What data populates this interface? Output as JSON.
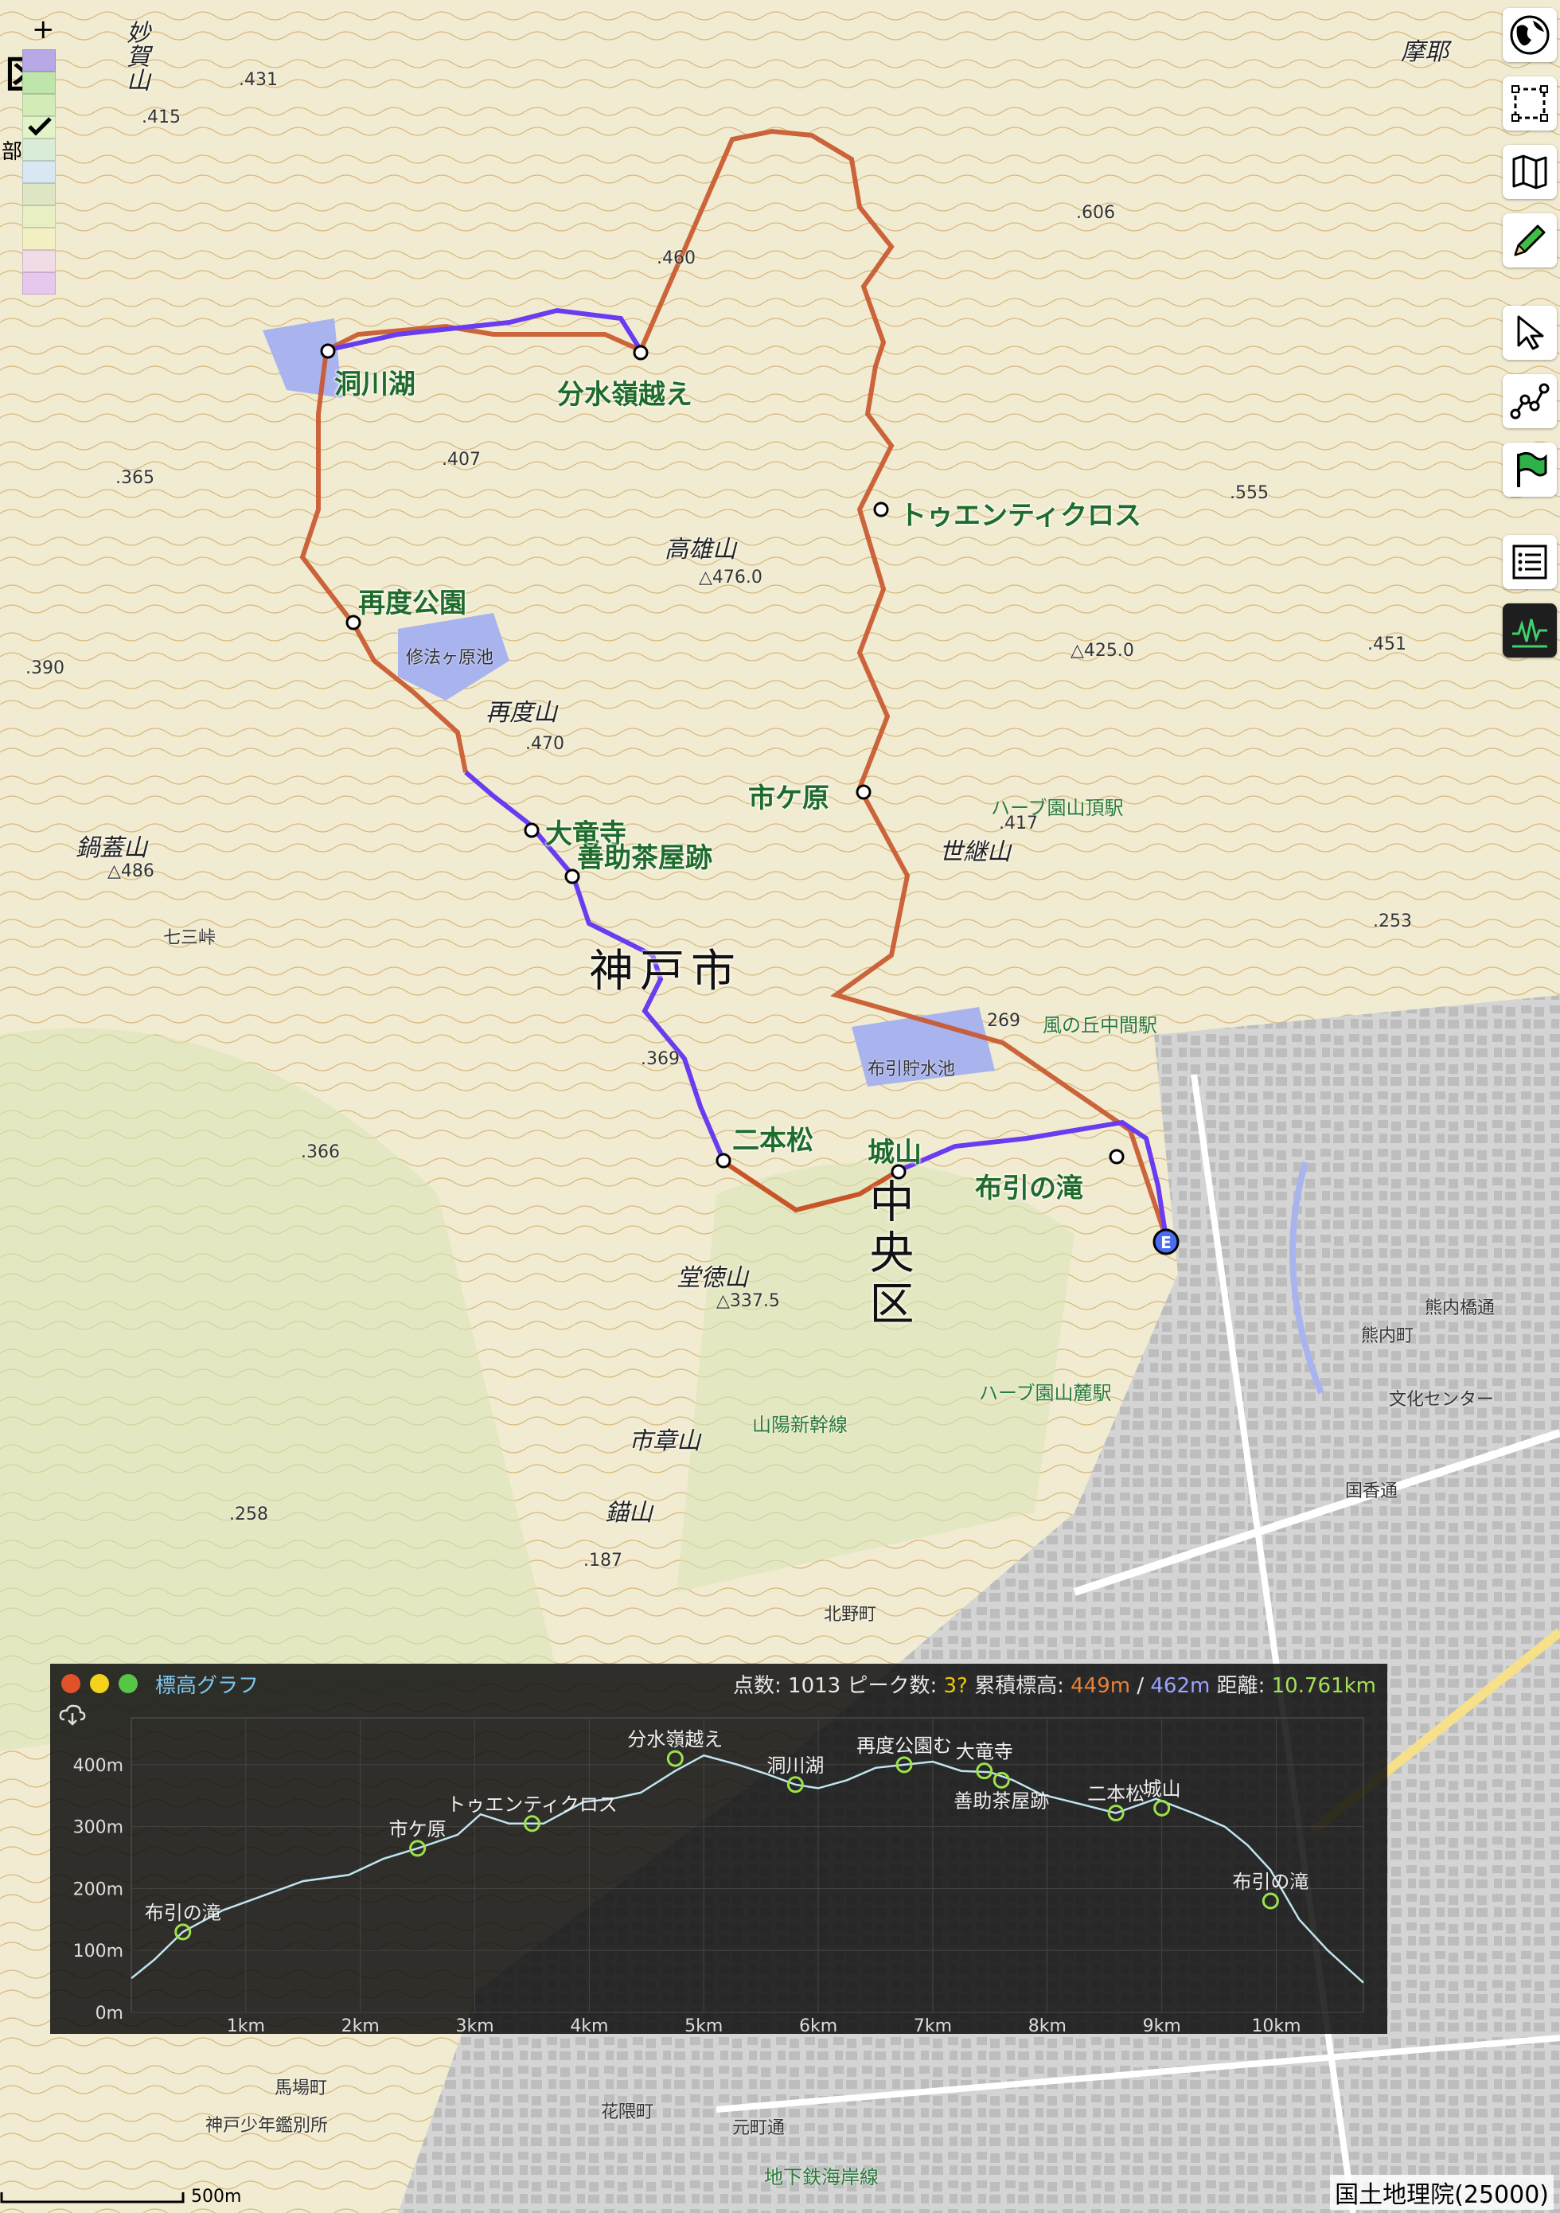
{
  "map": {
    "city_label": "神戸市",
    "ward_label": "中央区",
    "waypoints": [
      "洞川湖",
      "分水嶺越え",
      "トゥエンティクロス",
      "再度公園",
      "市ケ原",
      "大竜寺",
      "善助茶屋跡",
      "二本松",
      "城山",
      "布引の滝"
    ],
    "mountains": [
      "妙賀山",
      "高雄山",
      "再度山",
      "鍋蓋山",
      "世継山",
      "堂徳山",
      "市章山",
      "錨山",
      "摩耶"
    ],
    "places": [
      "修法ヶ原池",
      "布引貯水池",
      "ハーブ園山頂駅",
      "風の丘中間駅",
      "ハーブ園山麓駅",
      "山陽新幹線",
      "熊内町",
      "熊内橋通",
      "文化センター",
      "国香通",
      "北野町",
      "馬場町",
      "神戸少年鑑別所",
      "花隈町",
      "元町通",
      "七三峠",
      "地下鉄海岸線"
    ],
    "spot_heights": [
      ".431",
      ".415",
      ".460",
      ".407",
      ".365",
      "△476.0",
      ".390",
      ".470",
      "△486",
      ".417",
      ".366",
      ".369",
      ".258",
      "△337.5",
      ".187",
      ".606",
      ".555",
      "△425.0",
      ".451",
      ".253",
      "269"
    ],
    "route_colors": {
      "ascent": "#c8552a",
      "descent": "#6a3cf0",
      "waypoint_fill": "#ffffff"
    },
    "end_marker": "E",
    "scale_label": "500m",
    "attribution": "国土地理院(25000)"
  },
  "legend": {
    "zoom_label": "+",
    "ward_symbol": "区",
    "side_text": "部",
    "checkbox_checked": true
  },
  "toolbar": [
    {
      "icon": "globe-icon"
    },
    {
      "icon": "select-rect-icon"
    },
    {
      "icon": "map-icon"
    },
    {
      "icon": "pencil-icon"
    },
    {
      "icon": "cursor-icon"
    },
    {
      "icon": "route-icon"
    },
    {
      "icon": "flag-icon"
    },
    {
      "icon": "list-icon"
    },
    {
      "icon": "elevation-icon"
    }
  ],
  "elevation": {
    "title": "標高グラフ",
    "stats": {
      "points_label": "点数:",
      "points": "1013",
      "peaks_label": "ピーク数:",
      "peaks": "3?",
      "gain_label": "累積標高:",
      "gain_up": "449m",
      "sep": "/",
      "gain_down": "462m",
      "dist_label": "距離:",
      "distance": "10.761km"
    },
    "colors": {
      "peaks": "#f0c800",
      "up": "#e8823a",
      "down": "#9aa3ff",
      "dist": "#a4e05a",
      "line": "#bfe5f0"
    },
    "chart_data": {
      "type": "line",
      "xlim": [
        0,
        10.761
      ],
      "ylim": [
        0,
        450
      ],
      "x_ticks": [
        "1km",
        "2km",
        "3km",
        "4km",
        "5km",
        "6km",
        "7km",
        "8km",
        "9km",
        "10km"
      ],
      "y_ticks": [
        "0m",
        "100m",
        "200m",
        "300m",
        "400m"
      ],
      "profile": [
        [
          0,
          55
        ],
        [
          0.2,
          85
        ],
        [
          0.45,
          130
        ],
        [
          0.8,
          165
        ],
        [
          1.1,
          185
        ],
        [
          1.5,
          212
        ],
        [
          1.9,
          222
        ],
        [
          2.2,
          248
        ],
        [
          2.5,
          265
        ],
        [
          2.85,
          287
        ],
        [
          3.05,
          320
        ],
        [
          3.3,
          305
        ],
        [
          3.6,
          305
        ],
        [
          3.95,
          340
        ],
        [
          4.2,
          345
        ],
        [
          4.45,
          355
        ],
        [
          4.75,
          390
        ],
        [
          5.0,
          415
        ],
        [
          5.3,
          400
        ],
        [
          5.55,
          385
        ],
        [
          5.8,
          368
        ],
        [
          6.0,
          362
        ],
        [
          6.25,
          375
        ],
        [
          6.5,
          395
        ],
        [
          7.0,
          405
        ],
        [
          7.25,
          390
        ],
        [
          7.5,
          388
        ],
        [
          7.7,
          375
        ],
        [
          7.95,
          352
        ],
        [
          8.3,
          336
        ],
        [
          8.6,
          322
        ],
        [
          8.95,
          345
        ],
        [
          9.3,
          320
        ],
        [
          9.55,
          300
        ],
        [
          9.75,
          270
        ],
        [
          9.95,
          230
        ],
        [
          10.2,
          150
        ],
        [
          10.45,
          100
        ],
        [
          10.761,
          48
        ]
      ],
      "markers": [
        {
          "label": "布引の滝",
          "x": 0.45,
          "y": 130
        },
        {
          "label": "市ケ原",
          "x": 2.5,
          "y": 265
        },
        {
          "label": "トゥエンティクロス",
          "x": 3.5,
          "y": 305
        },
        {
          "label": "分水嶺越え",
          "x": 4.75,
          "y": 410
        },
        {
          "label": "洞川湖",
          "x": 5.8,
          "y": 368
        },
        {
          "label": "再度公園む",
          "x": 6.75,
          "y": 400
        },
        {
          "label": "大竜寺",
          "x": 7.45,
          "y": 390
        },
        {
          "label": "善助茶屋跡",
          "x": 7.6,
          "y": 375
        },
        {
          "label": "二本松",
          "x": 8.6,
          "y": 322
        },
        {
          "label": "城山",
          "x": 9.0,
          "y": 330
        },
        {
          "label": "布引の滝",
          "x": 9.95,
          "y": 180
        }
      ]
    }
  }
}
